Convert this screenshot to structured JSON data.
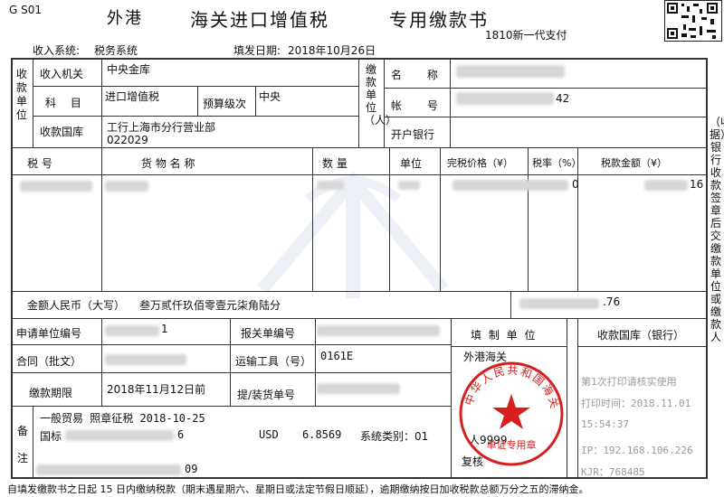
{
  "header": {
    "code": "G S01",
    "port": "外港",
    "title": "海关进口增值税",
    "subtitle": "专用缴款书",
    "system_label": "收入系统:",
    "system_value": "税务系统",
    "date_label": "填发日期:",
    "date_value": "2018年10月26日",
    "payment_channel": "1810新一代支付"
  },
  "left_payee": {
    "side_label": "收款单位",
    "org_label": "收入机关",
    "org_value": "中央金库",
    "subject_label": "科 目",
    "subject_value": "进口增值税",
    "budget_label": "预算级次",
    "budget_value": "中央",
    "treasury_label": "收款国库",
    "treasury_value": "工行上海市分行营业部",
    "treasury_code": "022029"
  },
  "right_payer": {
    "side_label": "缴款单位（人）",
    "name_label": "名 称",
    "name_value": "",
    "account_label": "帐 号",
    "account_tail": "42",
    "bank_label": "开户银行",
    "bank_value": ""
  },
  "goods_table": {
    "headers": [
      "税 号",
      "货 物 名 称",
      "数 量",
      "单位",
      "完税价格（¥）",
      "税率（%）",
      "税款金额（¥）"
    ],
    "row": {
      "tax_no": "",
      "goods_name": "",
      "quantity": "",
      "unit": "",
      "price_tail": "0",
      "rate": "",
      "amount_tail": "16"
    }
  },
  "amount_row": {
    "label": "金额人民币（大写）",
    "value": "叁万贰仟玖佰零壹元柒角陆分",
    "total_tail": ".76"
  },
  "info_rows": {
    "applicant_label": "申请单位编号",
    "applicant_tail": "1",
    "declaration_label": "报关单编号",
    "declaration_value": "",
    "contract_label": "合同（批文）",
    "transport_label": "运输工具（号）",
    "transport_value": "0161E",
    "deadline_label": "缴款期限",
    "deadline_value": "2018年11月12日前",
    "bill_label": "提/装货单号",
    "bill_value": "",
    "issuer_label": "填 制 单 位",
    "issuer_value": "外港海关",
    "treasury_bank_label": "收款国库（银行）"
  },
  "remarks": {
    "side_label": "备注",
    "line1": "一般贸易 照章征税 2018-10-25",
    "line2_prefix": "国标",
    "line2_tail": "6",
    "currency": "USD",
    "rate": "6.8569",
    "system_type": "系统类别：01",
    "preparer": "人9999",
    "reviewer": "复核",
    "line3_tail": "09"
  },
  "stamp": {
    "ring_text": "中华人民共和国海关",
    "center_text": "单证专用章"
  },
  "print_info": {
    "line1": "第1次打印请核实使用",
    "line2": "打印时间：2018.11.01",
    "line3": "15:54:37",
    "line4": "IP：192.168.106.226",
    "line5": "KJR：768485"
  },
  "right_strip": "（收据）银行收款签章后交缴款单位或缴款人",
  "footer": "自填发缴款书之日起 15 日内缴纳税款（期末遇星期六、星期日或法定节假日顺延），逾期缴纳按日加收税款总额万分之五的滞纳金。",
  "colors": {
    "stamp_red": "#d6201f",
    "text": "#111111",
    "grid": "#333333"
  }
}
